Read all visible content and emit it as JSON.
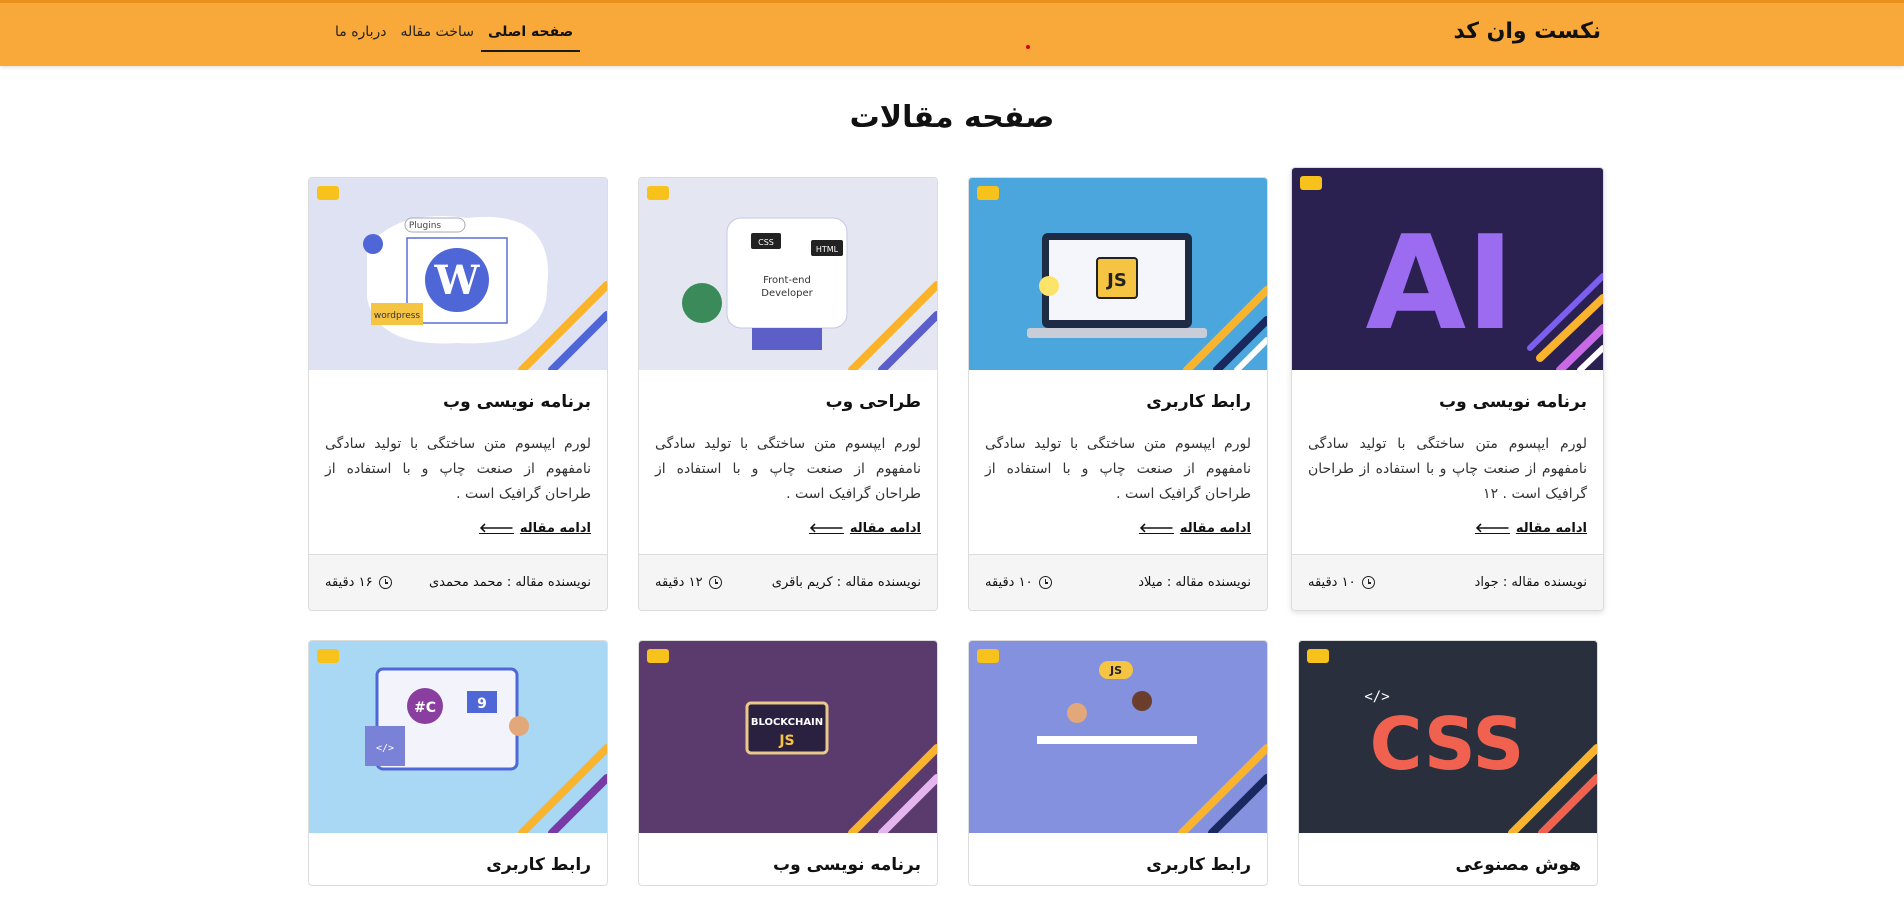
{
  "header": {
    "logo": "نکست وان کد",
    "nav": [
      {
        "label": "صفحه اصلی",
        "active": true
      },
      {
        "label": "ساخت مقاله",
        "active": false
      },
      {
        "label": "درباره ما",
        "active": false
      }
    ]
  },
  "page_title": "صفحه مقالات",
  "read_more_label": "ادامه مقاله",
  "cards_row1": [
    {
      "title": "برنامه نویسی وب",
      "desc": "لورم ایپسوم متن ساختگی با تولید سادگی نامفهوم از صنعت چاپ و با استفاده از طراحان گرافیک است . ۱۲",
      "author": "نویسنده مقاله : جواد",
      "time": "۱۰ دقیقه",
      "image": "ai-icon"
    },
    {
      "title": "رابط کاربری",
      "desc": "لورم ایپسوم متن ساختگی با تولید سادگی نامفهوم از صنعت چاپ و با استفاده از طراحان گرافیک است .",
      "author": "نویسنده مقاله : میلاد",
      "time": "۱۰ دقیقه",
      "image": "js-laptop-icon"
    },
    {
      "title": "طراحی وب",
      "desc": "لورم ایپسوم متن ساختگی با تولید سادگی نامفهوم از صنعت چاپ و با استفاده از طراحان گرافیک است .",
      "author": "نویسنده مقاله : کریم باقری",
      "time": "۱۲ دقیقه",
      "image": "frontend-developer-icon"
    },
    {
      "title": "برنامه نویسی وب",
      "desc": "لورم ایپسوم متن ساختگی با تولید سادگی نامفهوم از صنعت چاپ و با استفاده از طراحان گرافیک است .",
      "author": "نویسنده مقاله : محمد محمدی",
      "time": "۱۶ دقیقه",
      "image": "wordpress-icon"
    }
  ],
  "cards_row2": [
    {
      "title": "هوش مصنوعی",
      "image": "css-icon"
    },
    {
      "title": "رابط کاربری",
      "image": "js-team-icon"
    },
    {
      "title": "برنامه نویسی وب",
      "image": "blockchain-js-icon"
    },
    {
      "title": "رابط کاربری",
      "image": "csharp-icon"
    }
  ],
  "thumb_text": {
    "ai": "AI",
    "js": "JS",
    "css_tag": "CSS",
    "html_tag": "HTML",
    "fe_line1": "Front-end",
    "fe_line2": "Developer",
    "plugins": "Plugins",
    "wordpress": "wordpress",
    "blockchain": "BLOCKCHAIN",
    "css_big": "CSS",
    "code": "</>",
    "nine": "9",
    "csharp": "C#"
  },
  "colors": {
    "header_bg": "#f9a93a",
    "ai_bg": "#2b2150",
    "js_bg": "#4aa6dd",
    "fe_bg": "#e4e6f2",
    "wp_bg": "#dfe2f3",
    "css_bg": "#2a2f3d",
    "team_bg": "#8391df",
    "chain_bg": "#5b3b6d",
    "csharp_bg": "#a9d8f5"
  }
}
